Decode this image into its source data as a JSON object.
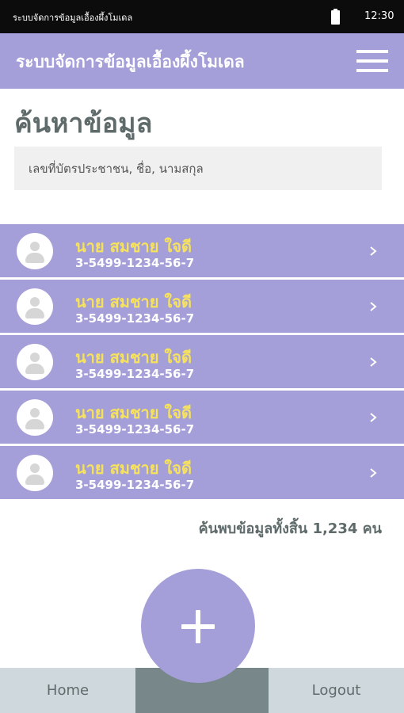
{
  "status_bar": {
    "title": "ระบบจัดการข้อมูลเอื้องผึ้งโมเดล",
    "time": "12:30",
    "icons": [
      "battery-icon"
    ]
  },
  "app_bar": {
    "title": "ระบบจัดการข้อมูลเอื้องผึ้งโมเดล",
    "menu_icon": "hamburger-menu-icon"
  },
  "page": {
    "title": "ค้นหาข้อมูล"
  },
  "search": {
    "placeholder": "เลขที่บัตรประชาชน, ชื่อ, นามสกุล",
    "value": ""
  },
  "results": [
    {
      "name": "นาย สมชาย ใจดี",
      "id_number": "3-5499-1234-56-7"
    },
    {
      "name": "นาย สมชาย ใจดี",
      "id_number": "3-5499-1234-56-7"
    },
    {
      "name": "นาย สมชาย ใจดี",
      "id_number": "3-5499-1234-56-7"
    },
    {
      "name": "นาย สมชาย ใจดี",
      "id_number": "3-5499-1234-56-7"
    },
    {
      "name": "นาย สมชาย ใจดี",
      "id_number": "3-5499-1234-56-7"
    }
  ],
  "summary": "ค้นพบข้อมูลทั้งสิ้น 1,234 คน",
  "fab": {
    "icon": "plus-icon"
  },
  "tab_bar": {
    "home_label": "Home",
    "middle_label": "",
    "logout_label": "Logout"
  },
  "colors": {
    "accent": "#a49fd8",
    "name_text": "#f6e25c",
    "heading_text": "#5f6b6b",
    "tab_bar_bg": "#cfd8dc",
    "tab_active_bg": "#78878a",
    "status_bar_bg": "#0c0c0c"
  }
}
